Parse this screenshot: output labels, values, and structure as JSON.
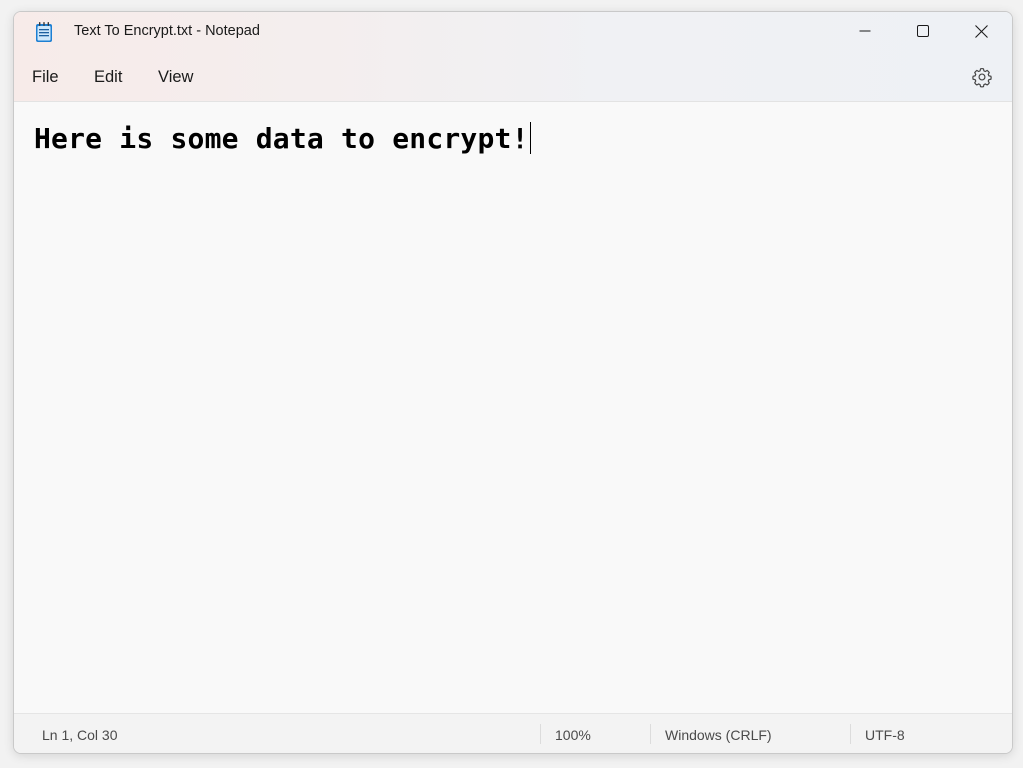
{
  "window": {
    "title": "Text To Encrypt.txt - Notepad",
    "app_icon": "notepad-icon"
  },
  "controls": {
    "minimize_icon": "minimize-icon",
    "maximize_icon": "maximize-icon",
    "close_icon": "close-icon"
  },
  "menu": {
    "items": [
      {
        "label": "File"
      },
      {
        "label": "Edit"
      },
      {
        "label": "View"
      }
    ],
    "settings_icon": "gear-icon"
  },
  "editor": {
    "content": "Here is some data to encrypt!"
  },
  "status": {
    "position": "Ln 1, Col 30",
    "zoom": "100%",
    "line_ending": "Windows (CRLF)",
    "encoding": "UTF-8"
  },
  "colors": {
    "title_gradient_start": "#f7ebe9",
    "title_gradient_end": "#eef1f5",
    "editor_bg": "#f9f9f9",
    "status_bg": "#f3f3f3"
  }
}
